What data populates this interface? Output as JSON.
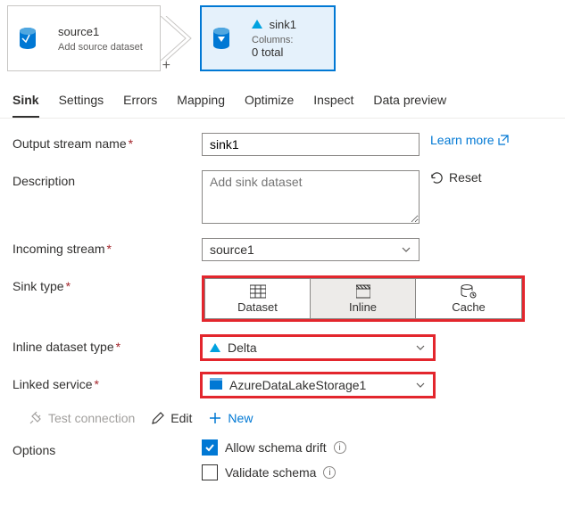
{
  "canvas": {
    "source": {
      "title": "source1",
      "subtitle": "Add source dataset"
    },
    "sink": {
      "title": "sink1",
      "columns_label": "Columns:",
      "columns_value": "0 total"
    }
  },
  "tabs": [
    "Sink",
    "Settings",
    "Errors",
    "Mapping",
    "Optimize",
    "Inspect",
    "Data preview"
  ],
  "active_tab": "Sink",
  "form": {
    "output_stream": {
      "label": "Output stream name",
      "value": "sink1"
    },
    "description": {
      "label": "Description",
      "placeholder": "Add sink dataset"
    },
    "incoming_stream": {
      "label": "Incoming stream",
      "value": "source1"
    },
    "sink_type": {
      "label": "Sink type",
      "options": [
        "Dataset",
        "Inline",
        "Cache"
      ],
      "selected": "Inline"
    },
    "inline_type": {
      "label": "Inline dataset type",
      "value": "Delta"
    },
    "linked_service": {
      "label": "Linked service",
      "value": "AzureDataLakeStorage1"
    },
    "options_label": "Options",
    "allow_drift": "Allow schema drift",
    "validate_schema": "Validate schema"
  },
  "links": {
    "learn_more": "Learn more",
    "reset": "Reset",
    "test_connection": "Test connection",
    "edit": "Edit",
    "new": "New"
  }
}
